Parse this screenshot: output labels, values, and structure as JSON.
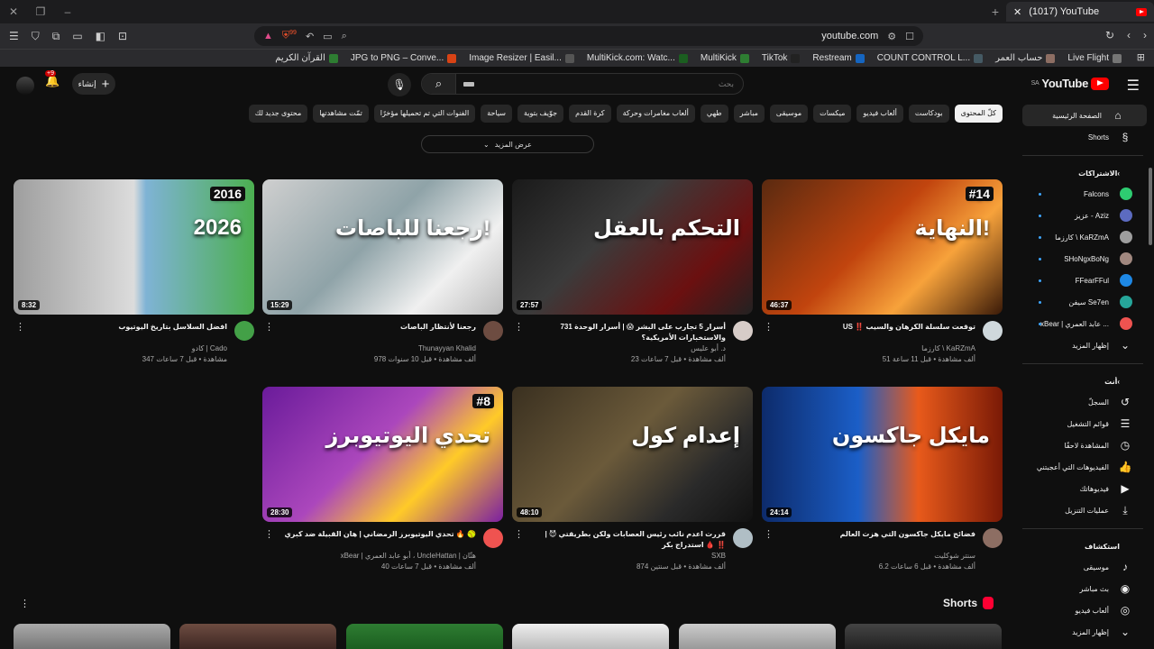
{
  "browser": {
    "tab_title": "(1017) YouTube",
    "url": "youtube.com",
    "shield_count": "99",
    "bookmarks": [
      {
        "label": "القرآن الكريم",
        "color": "#2e7d32"
      },
      {
        "label": "JPG to PNG – Conve...",
        "color": "#d84315"
      },
      {
        "label": "Image Resizer | Easil...",
        "color": "#555555"
      },
      {
        "label": "MultiKick.com: Watc...",
        "color": "#1b5e20"
      },
      {
        "label": "MultiKick",
        "color": "#2e7d32"
      },
      {
        "label": "TikTok",
        "color": "#222222"
      },
      {
        "label": "Restream",
        "color": "#1565c0"
      },
      {
        "label": "COUNT CONTROL L...",
        "color": "#455a64"
      },
      {
        "label": "حساب العمر",
        "color": "#8d6e63"
      },
      {
        "label": "Live Flight",
        "color": "#757575"
      }
    ]
  },
  "header": {
    "logo_text": "YouTube",
    "region": "SA",
    "search_placeholder": "بحث",
    "create_label": "إنشاء",
    "notif_count": "+9"
  },
  "chips": [
    "كلّ المحتوى",
    "بودكاست",
    "ألعاب فيديو",
    "ميكسات",
    "موسيقى",
    "مباشر",
    "طهي",
    "ألعاب مغامرات وحركة",
    "كرة القدم",
    "جوّيف بتوية",
    "سياحة",
    "الفنوات التي تم تحميلها مؤخرًا",
    "تمّت مشاهدتها",
    "محتوى جديد لك"
  ],
  "more_label": "عرض المزيد",
  "sidebar": {
    "main": [
      {
        "label": "الصفحة الرئيسية",
        "icon": "home-icon",
        "glyph": "⌂",
        "active": true
      },
      {
        "label": "Shorts",
        "icon": "shorts-icon",
        "glyph": "§",
        "active": false
      }
    ],
    "subs_title": "الاشتراكات",
    "subs": [
      {
        "label": "Falcons",
        "color": "#2ecc71"
      },
      {
        "label": "عزيز - Aziz",
        "color": "#5c6bc0"
      },
      {
        "label": "كارزما \\ KaRZmA",
        "color": "#9e9e9e"
      },
      {
        "label": "SHoNgxBoNg",
        "color": "#a1887f"
      },
      {
        "label": "FFearFFul",
        "color": "#1e88e5"
      },
      {
        "label": "سيفن Se7en",
        "color": "#26a69a"
      },
      {
        "label": "xBear | عابد العمري ...",
        "color": "#ef5350"
      }
    ],
    "subs_more": "إظهار المزيد",
    "you_title": "أنت",
    "you": [
      {
        "label": "السجلّ",
        "icon": "history-icon",
        "glyph": "↺"
      },
      {
        "label": "قوائم التشغيل",
        "icon": "playlists-icon",
        "glyph": "☰"
      },
      {
        "label": "المشاهدة لاحقًا",
        "icon": "watch-later-icon",
        "glyph": "◷"
      },
      {
        "label": "الفيديوهات التي أعجبتني",
        "icon": "like-icon",
        "glyph": "👍"
      },
      {
        "label": "فيديوهاتك",
        "icon": "your-videos-icon",
        "glyph": "▶"
      },
      {
        "label": "عمليات التنزيل",
        "icon": "download-icon",
        "glyph": "⤓"
      }
    ],
    "explore_title": "استكشاف",
    "explore": [
      {
        "label": "موسيقى",
        "icon": "music-icon",
        "glyph": "♪"
      },
      {
        "label": "بث مباشر",
        "icon": "live-icon",
        "glyph": "◉"
      },
      {
        "label": "ألعاب فيديو",
        "icon": "gaming-icon",
        "glyph": "◎"
      },
      {
        "label": "إظهار المزيد",
        "icon": "chevron-down-icon",
        "glyph": "⌄"
      }
    ]
  },
  "videos": [
    {
      "title": "US ‼️ توقعت سلسلة الكرهان والسيب",
      "channel": "كارزما \\ KaRZmA",
      "stats": "51 ألف مشاهدة • قبل 11 ساعة",
      "duration": "46:37",
      "thumb_text": "النهاية!",
      "badge": "#14",
      "bg": "linear-gradient(135deg,#5a2a10 0%,#c1440e 45%,#f7a23b 70%,#3a1a08 100%)",
      "av": "#cfd8dc"
    },
    {
      "title": "أسرار 5 تجارب على البشر 😱 | أسرار الوحدة 731 والاستخبارات الأمريكية؟",
      "channel": "د. أبو عليس",
      "stats": "23 ألف مشاهدة • قبل 7 ساعات",
      "duration": "27:57",
      "thumb_text": "التحكم بالعقل",
      "badge": "",
      "bg": "linear-gradient(135deg,#1a1a1a 0%,#3b3b3b 40%,#6b1010 75%,#222 100%)",
      "av": "#d7ccc8"
    },
    {
      "title": "رجعنا لأنتظار الباصات",
      "channel": "Thunayyan Khalid",
      "stats": "978 ألف مشاهدة • قبل 10 سنوات",
      "duration": "15:29",
      "thumb_text": "رجعنا للباصات!",
      "badge": "",
      "bg": "linear-gradient(135deg,#cfcfcf 0%,#8fa3a8 45%,#f0f0f0 75%,#bbb 100%)",
      "av": "#6d4c41"
    },
    {
      "title": "افضل السلاسل بتاريخ اليوتيوب",
      "channel": "كادو | Cado",
      "stats": "347 مشاهدة • قبل 7 ساعات",
      "duration": "8:32",
      "thumb_text": "2026",
      "badge": "2016",
      "bg": "linear-gradient(90deg,#9e9e9e 0%,#dcdcdc 50%,#7fb3d5 55%,#4caf50 100%)",
      "av": "#43a047"
    },
    {
      "title": "فضائح مايكل جاكسون التي هزت العالم",
      "channel": "سنتر شوكليت",
      "stats": "6.2 ألف مشاهدة • قبل 6 ساعات",
      "duration": "24:14",
      "thumb_text": "مايكل جاكسون",
      "badge": "",
      "bg": "linear-gradient(90deg,#0d2b6b 0%,#1b5ec7 40%,#e85a1b 65%,#7a1a06 100%)",
      "av": "#8d6e63"
    },
    {
      "title": "قررت اعدم نائب رئيس العصابات ولكن بطريقتي 😈 | استدراج بكر 🩸 ‼️",
      "channel": "SXB",
      "stats": "874 ألف مشاهدة • قبل سنتين",
      "duration": "48:10",
      "thumb_text": "إعدام كول",
      "badge": "",
      "bg": "linear-gradient(135deg,#3a3020 0%,#6b5a3a 45%,#2a2a2a 75%,#111 100%)",
      "av": "#b0bec5"
    },
    {
      "title": "تحدي اليوتيوبرز الرمضاني | هان القبيلة ضد كبري 🔥 🥎",
      "channel": "xBear | أبو عابد العمري ، UncleHattan | هتّان",
      "stats": "40 ألف مشاهدة • قبل 7 ساعات",
      "duration": "28:30",
      "thumb_text": "تحدي اليوتيوبرز",
      "badge": "#8",
      "bg": "linear-gradient(135deg,#6a1b9a 0%,#ab47bc 45%,#ffca28 70%,#7b1fa2 100%)",
      "av": "#ef5350"
    }
  ],
  "shorts_title": "Shorts"
}
